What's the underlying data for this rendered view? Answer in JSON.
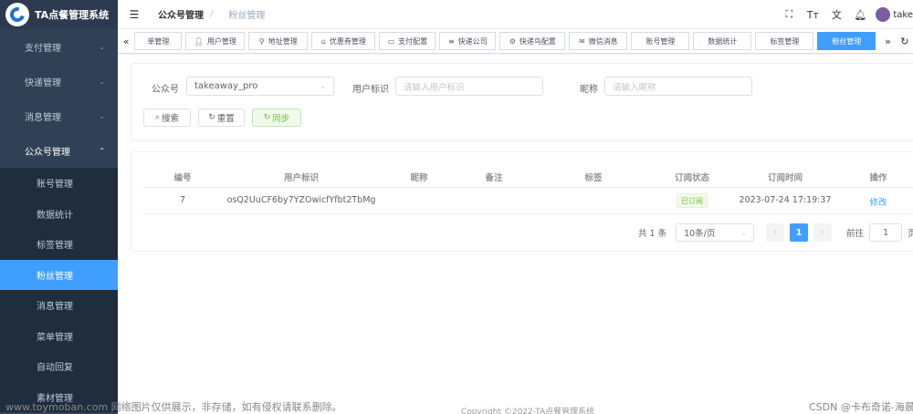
{
  "app": {
    "title": "TA点餐管理系统"
  },
  "sidebar": {
    "items": [
      {
        "label": "支付管理"
      },
      {
        "label": "快递管理"
      },
      {
        "label": "消息管理"
      },
      {
        "label": "公众号管理"
      }
    ],
    "subitems": [
      {
        "label": "账号管理"
      },
      {
        "label": "数据统计"
      },
      {
        "label": "标签管理"
      },
      {
        "label": "粉丝管理"
      },
      {
        "label": "消息管理"
      },
      {
        "label": "菜单管理"
      },
      {
        "label": "自动回复"
      },
      {
        "label": "素材管理"
      }
    ]
  },
  "navbar": {
    "breadcrumb": [
      "公众号管理",
      "/",
      "粉丝管理"
    ],
    "user": "take"
  },
  "tags": [
    {
      "label": "单管理",
      "icon": ""
    },
    {
      "label": "用户管理",
      "icon": "user-icon"
    },
    {
      "label": "地址管理",
      "icon": "location-icon"
    },
    {
      "label": "优惠券管理",
      "icon": "coupon-icon"
    },
    {
      "label": "支付配置",
      "icon": "card-icon"
    },
    {
      "label": "快递公司",
      "icon": "list-icon"
    },
    {
      "label": "快递鸟配置",
      "icon": "gear-icon"
    },
    {
      "label": "微信消息",
      "icon": "message-icon"
    },
    {
      "label": "账号管理",
      "icon": ""
    },
    {
      "label": "数据统计",
      "icon": ""
    },
    {
      "label": "标签管理",
      "icon": ""
    },
    {
      "label": "粉丝管理",
      "icon": ""
    }
  ],
  "search": {
    "account_label": "公众号",
    "account_value": "takeaway_pro",
    "openid_label": "用户标识",
    "openid_placeholder": "请输入用户标识",
    "nickname_label": "昵称",
    "nickname_placeholder": "请输入昵称",
    "search_btn": "搜索",
    "reset_btn": "重置",
    "sync_btn": "同步"
  },
  "table": {
    "headers": [
      "编号",
      "用户标识",
      "昵称",
      "备注",
      "标签",
      "订阅状态",
      "订阅时间",
      "操作"
    ],
    "rows": [
      {
        "id": "7",
        "openid": "osQ2UuCF6by7YZOwicfYfbt2TbMg",
        "nickname": "",
        "remark": "",
        "tags": "",
        "status": "已订阅",
        "time": "2023-07-24 17:19:37",
        "action": "修改"
      }
    ]
  },
  "pagination": {
    "total": "共 1 条",
    "page_size": "10条/页",
    "current": "1",
    "goto_label": "前往",
    "goto_value": "1",
    "page_suffix": "页"
  },
  "footer": {
    "copyright": "Copyright ©2022-TA点餐管理系统",
    "watermark_left": "www.toymoban.com 网络图片仅供展示，非存储，如有侵权请联系删除。",
    "watermark_right": "CSDN @卡布奇诺-海晨"
  }
}
